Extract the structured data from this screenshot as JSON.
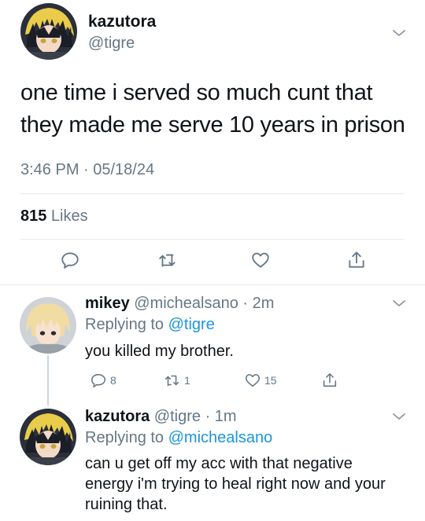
{
  "main_tweet": {
    "display_name": "kazutora",
    "handle": "@tigre",
    "text": "one time i served so much cunt that they made me serve 10 years in prison",
    "timestamp": "3:46 PM · 05/18/24",
    "likes_count": "815",
    "likes_label": " Likes",
    "avatar_icon": "anime-avatar-kazutora",
    "actions": [
      "reply-icon",
      "retweet-icon",
      "like-icon",
      "share-icon"
    ]
  },
  "replies": [
    {
      "display_name": "mikey",
      "meta": " @michealsano · 2m",
      "replying_prefix": "Replying to ",
      "replying_to": "@tigre",
      "text": "you killed my brother.",
      "reply_count": "8",
      "retweet_count": "1",
      "like_count": "15",
      "avatar_icon": "anime-avatar-mikey"
    },
    {
      "display_name": "kazutora",
      "meta": " @tigre · 1m",
      "replying_prefix": "Replying to ",
      "replying_to": "@michealsano",
      "text": "can u get off my acc with that negative energy i'm trying to heal right now and your ruining that.",
      "avatar_icon": "anime-avatar-kazutora"
    }
  ],
  "colors": {
    "text": "#0f1419",
    "secondary": "#657786",
    "link": "#1b95e0",
    "divider": "#e6ecf0"
  }
}
